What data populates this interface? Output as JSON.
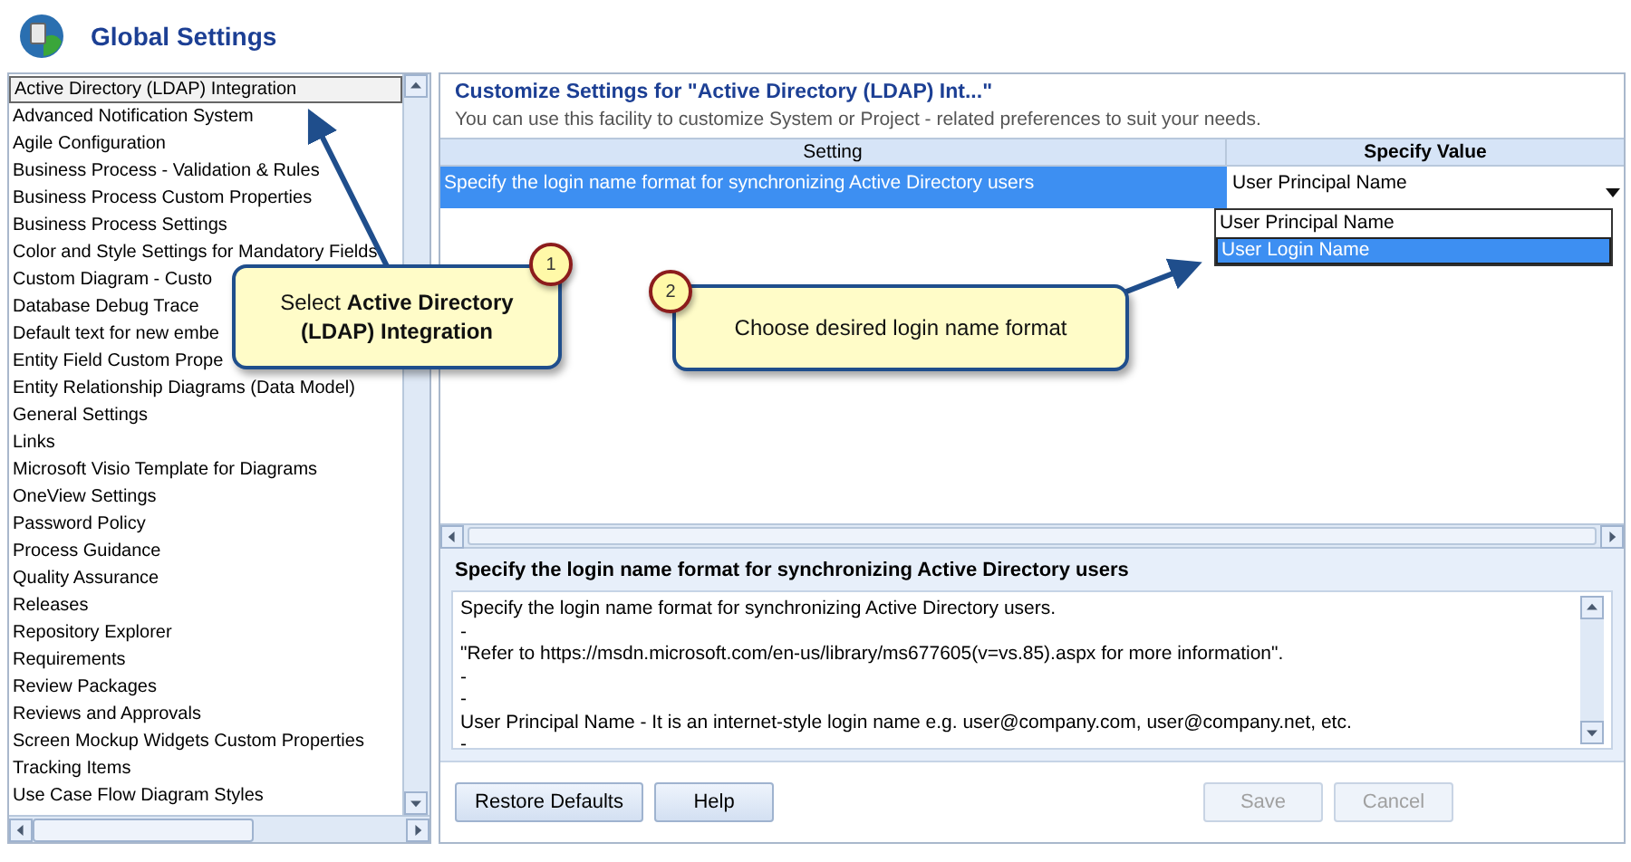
{
  "window": {
    "title": "Global Settings"
  },
  "categories": [
    {
      "label": "Active Directory (LDAP) Integration",
      "selected": true
    },
    {
      "label": "Advanced Notification System",
      "selected": false
    },
    {
      "label": "Agile Configuration",
      "selected": false
    },
    {
      "label": "Business Process - Validation & Rules",
      "selected": false
    },
    {
      "label": "Business Process Custom Properties",
      "selected": false
    },
    {
      "label": "Business Process Settings",
      "selected": false
    },
    {
      "label": "Color and Style Settings for Mandatory Fields",
      "selected": false
    },
    {
      "label": "Custom Diagram - Custo",
      "selected": false
    },
    {
      "label": "Database Debug Trace",
      "selected": false
    },
    {
      "label": "Default text for new embe",
      "selected": false
    },
    {
      "label": "Entity Field Custom Prope",
      "selected": false
    },
    {
      "label": "Entity Relationship Diagrams (Data Model)",
      "selected": false
    },
    {
      "label": "General Settings",
      "selected": false
    },
    {
      "label": "Links",
      "selected": false
    },
    {
      "label": "Microsoft Visio Template for Diagrams",
      "selected": false
    },
    {
      "label": "OneView Settings",
      "selected": false
    },
    {
      "label": "Password Policy",
      "selected": false
    },
    {
      "label": "Process Guidance",
      "selected": false
    },
    {
      "label": "Quality Assurance",
      "selected": false
    },
    {
      "label": "Releases",
      "selected": false
    },
    {
      "label": "Repository Explorer",
      "selected": false
    },
    {
      "label": "Requirements",
      "selected": false
    },
    {
      "label": "Review Packages",
      "selected": false
    },
    {
      "label": "Reviews and Approvals",
      "selected": false
    },
    {
      "label": "Screen Mockup Widgets Custom Properties",
      "selected": false
    },
    {
      "label": "Tracking Items",
      "selected": false
    },
    {
      "label": "Use Case Flow Diagram Styles",
      "selected": false
    }
  ],
  "panel": {
    "title": "Customize Settings for \"Active Directory (LDAP) Int...\"",
    "subtitle": "You can use this facility to customize System or Project - related preferences to suit your needs."
  },
  "table": {
    "columns": [
      "Setting",
      "Specify Value"
    ],
    "rows": [
      {
        "setting": "Specify the login name format for synchronizing Active Directory users",
        "value": "User Principal Name",
        "selected": true
      }
    ]
  },
  "dropdown": {
    "options": [
      {
        "label": "User Principal Name",
        "selected": false
      },
      {
        "label": "User Login Name",
        "selected": true
      }
    ]
  },
  "description": {
    "title": "Specify the login name format for synchronizing Active Directory users",
    "lines": [
      "Specify the login name format for synchronizing Active Directory users.",
      "-",
      "\"Refer to https://msdn.microsoft.com/en-us/library/ms677605(v=vs.85).aspx for more information\".",
      "-",
      "-",
      "User Principal Name - It is an internet-style login name e.g. user@company.com, user@company.net, etc.",
      "-"
    ]
  },
  "buttons": [
    {
      "label": "Restore Defaults",
      "disabled": false
    },
    {
      "label": "Help",
      "disabled": false
    },
    {
      "label": "Save",
      "disabled": true
    },
    {
      "label": "Cancel",
      "disabled": true
    }
  ],
  "callouts": [
    {
      "number": "1",
      "text": "Select **Active Directory (LDAP) Integration**"
    },
    {
      "number": "2",
      "text": "Choose desired login name format"
    }
  ]
}
